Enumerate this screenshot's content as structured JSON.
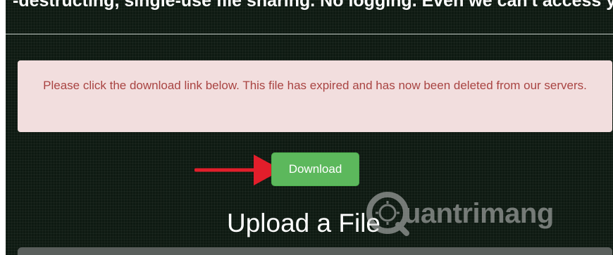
{
  "header": {
    "tagline": "-destructing, single-use file sharing. No logging. Even we can't access your"
  },
  "alert": {
    "message": "Please click the download link below. This file has expired and has now been deleted from our servers."
  },
  "actions": {
    "download_label": "Download"
  },
  "upload": {
    "title": "Upload a File"
  },
  "watermark": {
    "text": "uantrimang"
  },
  "colors": {
    "background": "#0e1a12",
    "alert_bg": "#f2dede",
    "alert_text": "#a94442",
    "button_bg": "#5cb85c",
    "annotation_arrow": "#e21e2b"
  },
  "icons": {
    "annotation": "red-arrow-icon",
    "watermark_logo": "quantrimang-logo-icon"
  }
}
